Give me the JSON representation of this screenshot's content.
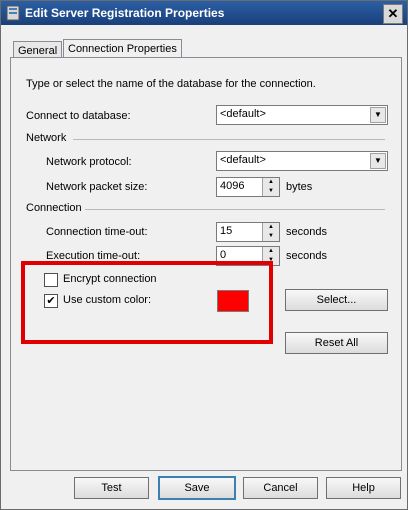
{
  "title": "Edit Server Registration Properties",
  "tabs": [
    "General",
    "Connection Properties"
  ],
  "intro": "Type or select the name of the database for the connection.",
  "connect_db": {
    "label": "Connect to database:",
    "value": "<default>"
  },
  "sections": {
    "network": "Network",
    "connection": "Connection"
  },
  "network_protocol": {
    "label": "Network protocol:",
    "value": "<default>"
  },
  "packet_size": {
    "label": "Network packet size:",
    "value": "4096",
    "unit": "bytes"
  },
  "conn_timeout": {
    "label": "Connection time-out:",
    "value": "15",
    "unit": "seconds"
  },
  "exec_timeout": {
    "label": "Execution time-out:",
    "value": "0",
    "unit": "seconds"
  },
  "encrypt": {
    "label": "Encrypt connection",
    "checked": false
  },
  "custom_color": {
    "label": "Use custom color:",
    "checked": true,
    "color": "#ff0000"
  },
  "buttons": {
    "select": "Select...",
    "reset": "Reset All",
    "test": "Test",
    "save": "Save",
    "cancel": "Cancel",
    "help": "Help"
  },
  "icons": {
    "close": "close-icon",
    "dropdown": "chevron-down-icon"
  }
}
